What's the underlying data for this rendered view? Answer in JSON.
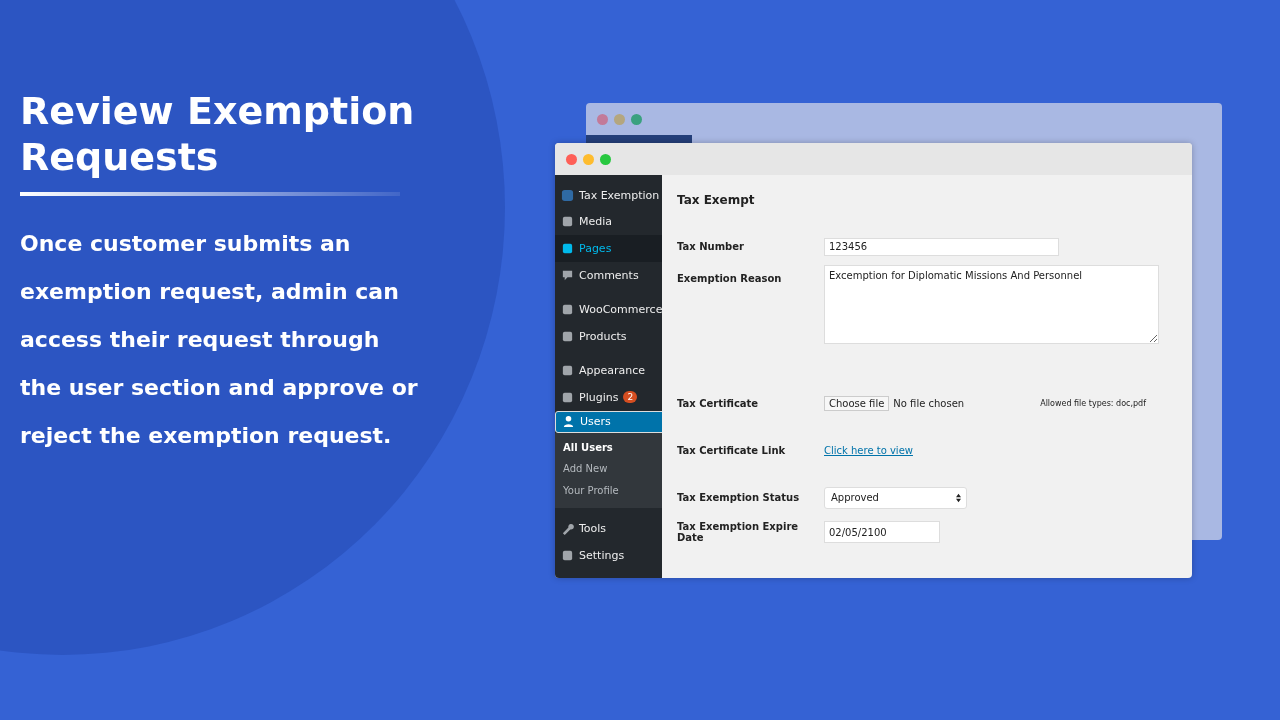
{
  "headline": "Review Exemption Requests",
  "description": "Once customer submits an exemption request, admin can access their request through the user section and approve or reject the exemption request.",
  "sidebar": {
    "items": [
      {
        "label": "Tax Exemption",
        "highlighted": false,
        "selected": false
      },
      {
        "label": "Media",
        "highlighted": false,
        "selected": false
      },
      {
        "label": "Pages",
        "highlighted": true,
        "selected": false
      },
      {
        "label": "Comments",
        "highlighted": false,
        "selected": false
      },
      {
        "label": "WooCommerce",
        "highlighted": false,
        "selected": false
      },
      {
        "label": "Products",
        "highlighted": false,
        "selected": false
      },
      {
        "label": "Appearance",
        "highlighted": false,
        "selected": false
      },
      {
        "label": "Plugins",
        "highlighted": false,
        "selected": false,
        "badge": "2"
      },
      {
        "label": "Users",
        "highlighted": false,
        "selected": true,
        "children": [
          {
            "label": "All Users",
            "selected": true
          },
          {
            "label": "Add New",
            "selected": false
          },
          {
            "label": "Your Profile",
            "selected": false
          }
        ]
      },
      {
        "label": "Tools",
        "highlighted": false,
        "selected": false
      },
      {
        "label": "Settings",
        "highlighted": false,
        "selected": false
      }
    ]
  },
  "form": {
    "title": "Tax Exempt",
    "rows": [
      {
        "kind": "text",
        "label": "Tax Number",
        "value": "123456"
      },
      {
        "kind": "textarea",
        "label": "Exemption Reason",
        "value": "Excemption for Diplomatic Missions And Personnel"
      },
      {
        "kind": "file",
        "label": "Tax Certificate",
        "button": "Choose file",
        "status": "No file chosen",
        "hint": "Allowed file types: doc,pdf"
      },
      {
        "kind": "link",
        "label": "Tax Certificate Link",
        "value": "Click here to view"
      },
      {
        "kind": "select",
        "label": "Tax Exemption Status",
        "value": "Approved"
      },
      {
        "kind": "date",
        "label": "Tax Exemption Expire Date",
        "value": "02/05/2100"
      }
    ]
  }
}
